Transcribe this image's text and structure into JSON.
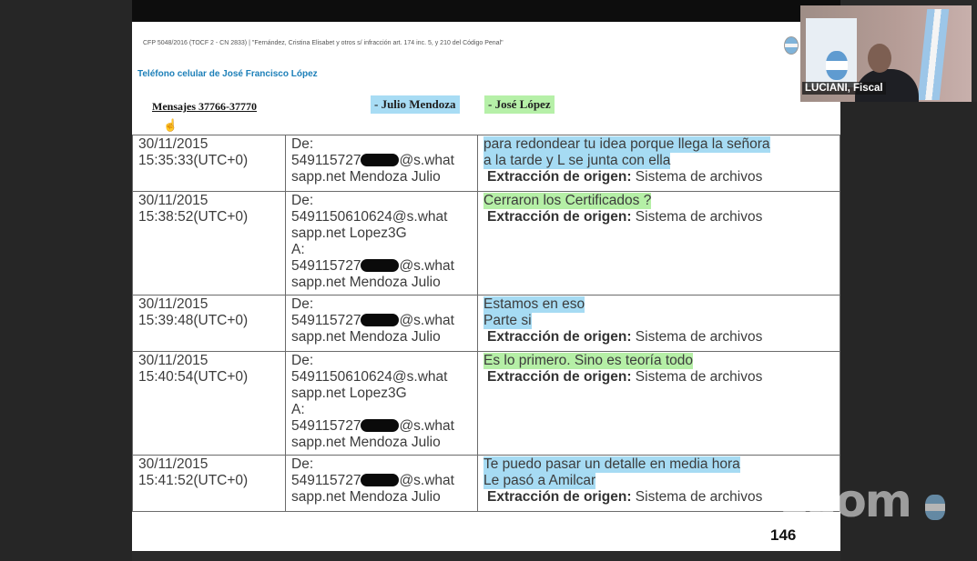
{
  "doc": {
    "case_header": "CFP 5048/2016 (TOCF 2 - CN 2833) | \"Fernández, Cristina Elisabet y otros s/ infracción art. 174 inc. 5, y 210 del Código Penal\"",
    "phone_title": "Teléfono celular de José Francisco López",
    "messages_range": "Mensajes 37766-37770",
    "legend_julio": "- Julio Mendoza",
    "legend_jose": "- José López",
    "page_number": "146",
    "extract_label": "Extracción de origen:",
    "extract_value": " Sistema de archivos",
    "rows": [
      {
        "date": "30/11/2015",
        "time": "15:35:33(UTC+0)",
        "from_label": "De:",
        "from_prefix": "549115727",
        "from_suffix": "@s.what",
        "from_tail": "sapp.net Mendoza Julio",
        "sender": "julio",
        "body": [
          "para redondear tu idea porque llega la señora",
          "a la tarde y L se  junta con ella"
        ]
      },
      {
        "date": "30/11/2015",
        "time": "15:38:52(UTC+0)",
        "from_label": "De:",
        "from_full": "5491150610624@s.what",
        "from_full_tail": "sapp.net Lopez3G",
        "to_label": "A:",
        "to_prefix": "549115727",
        "to_suffix": "@s.what",
        "to_tail": "sapp.net Mendoza Julio",
        "sender": "jose",
        "body": [
          "Cerraron los Certificados ?"
        ]
      },
      {
        "date": "30/11/2015",
        "time": "15:39:48(UTC+0)",
        "from_label": "De:",
        "from_prefix": "549115727",
        "from_suffix": "@s.what",
        "from_tail": "sapp.net Mendoza Julio",
        "sender": "julio",
        "body": [
          "Estamos en eso",
          "Parte si"
        ]
      },
      {
        "date": "30/11/2015",
        "time": "15:40:54(UTC+0)",
        "from_label": "De:",
        "from_full": "5491150610624@s.what",
        "from_full_tail": "sapp.net Lopez3G",
        "to_label": "A:",
        "to_prefix": "549115727",
        "to_suffix": "@s.what",
        "to_tail": "sapp.net Mendoza Julio",
        "sender": "jose",
        "body": [
          "Es lo primero. Sino es teoría todo"
        ]
      },
      {
        "date": "30/11/2015",
        "time": "15:41:52(UTC+0)",
        "from_label": "De:",
        "from_prefix": "549115727",
        "from_suffix": "@s.what",
        "from_tail": "sapp.net Mendoza Julio",
        "sender": "julio",
        "body": [
          "Te puedo pasar un detalle en media hora",
          "Le pasó a Amilcar"
        ]
      }
    ]
  },
  "video": {
    "participant_name": "LUCIANI, Fiscal"
  },
  "branding": {
    "zoom_logo": "zoom"
  },
  "colors": {
    "julio_highlight": "#a6dbf3",
    "jose_highlight": "#b5efa6",
    "title_blue": "#1c7fb8"
  }
}
